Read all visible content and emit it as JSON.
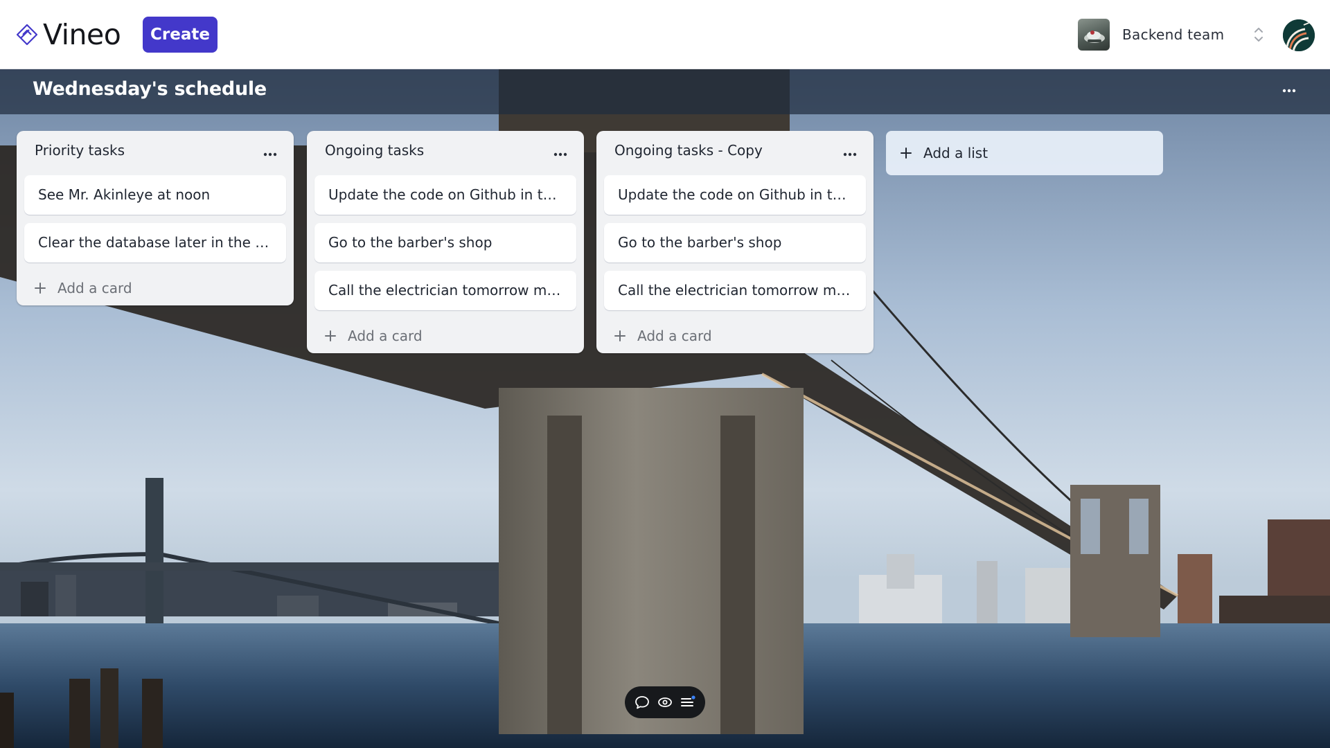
{
  "app": {
    "name": "Vineo",
    "create_label": "Create"
  },
  "team": {
    "name": "Backend team"
  },
  "board": {
    "title": "Wednesday's schedule"
  },
  "lists": [
    {
      "title": "Priority tasks",
      "cards": [
        "See Mr. Akinleye at noon",
        "Clear the database later in the day"
      ],
      "add_card_label": "Add a card"
    },
    {
      "title": "Ongoing tasks",
      "cards": [
        "Update the code on Github in the…",
        "Go to the barber's shop",
        "Call the electrician tomorrow mor…"
      ],
      "add_card_label": "Add a card"
    },
    {
      "title": "Ongoing tasks - Copy",
      "cards": [
        "Update the code on Github in the…",
        "Go to the barber's shop",
        "Call the electrician tomorrow mor…"
      ],
      "add_card_label": "Add a card"
    }
  ],
  "add_list_label": "Add a list",
  "icons": {
    "logo": "vineo-logo-icon",
    "team_thumb": "team-thumbnail",
    "team_switch": "chevron-up-down-icon",
    "avatar": "user-avatar",
    "board_menu": "more-horizontal-icon",
    "list_menu": "more-horizontal-icon",
    "add": "plus-icon",
    "dock": [
      "comment-icon",
      "eye-icon",
      "list-icon"
    ]
  },
  "colors": {
    "brand": "#4338ca",
    "list_bg": "#f1f2f4",
    "dock_bg": "#17191c",
    "notification_dot": "#3b82f6"
  }
}
